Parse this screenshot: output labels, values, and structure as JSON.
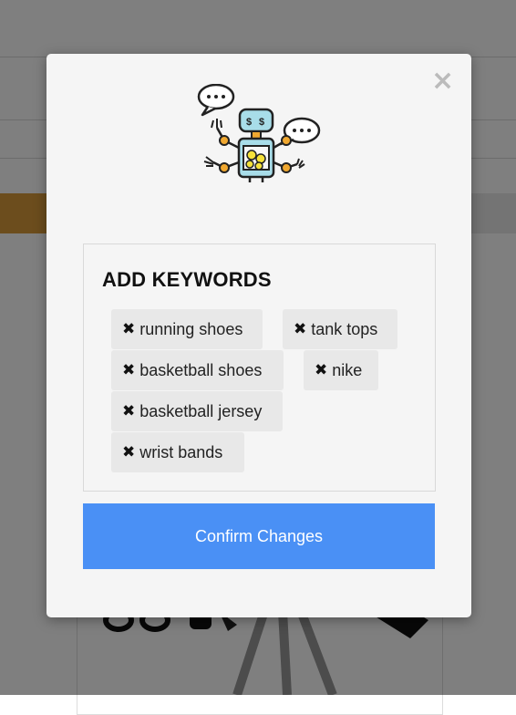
{
  "modal": {
    "title": "ADD KEYWORDS",
    "close_icon": "close-icon",
    "illustration": "robot-with-speech-bubbles-icon",
    "keywords": [
      "running shoes",
      "tank tops",
      "basketball shoes",
      "nike",
      "basketball jersey",
      "wrist bands"
    ],
    "remove_glyph": "✖",
    "confirm_label": "Confirm Changes"
  },
  "colors": {
    "accent_button": "#4a90f5",
    "chip_bg": "#e8e8e8",
    "modal_bg": "#f5f5f5",
    "background_accent": "#d99a3a"
  }
}
